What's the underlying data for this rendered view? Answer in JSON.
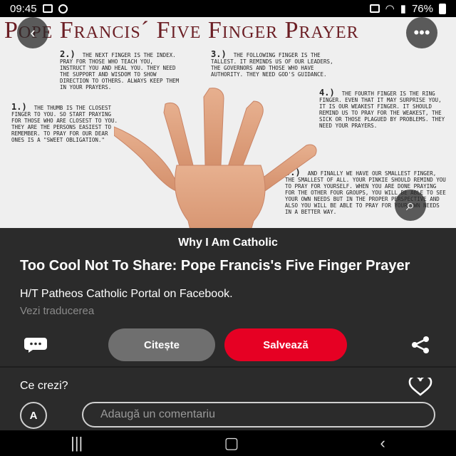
{
  "status_bar": {
    "time": "09:45",
    "battery": "76%"
  },
  "image": {
    "title": "Pope Francis´ Five Finger Prayer",
    "steps": [
      {
        "num": "1.)",
        "text": "The thumb is the closest finger to you. So start praying for those who are closest to you. They are the persons easiest to remember. To pray for our dear ones is a \"sweet obligation.\""
      },
      {
        "num": "2.)",
        "text": "The next finger is the index. Pray for those who teach you, instruct you and heal you. They need the support and wisdom to show direction to others. Always keep them in your prayers."
      },
      {
        "num": "3.)",
        "text": "The following finger is the tallest. It reminds us of our leaders, the governors and those who have authority. They need God's guidance."
      },
      {
        "num": "4.)",
        "text": "The fourth finger is the ring finger. Even that it may surprise you, it is our weakest finger. It should remind us to pray for the weakest, the sick or those plagued by problems. They need your prayers."
      },
      {
        "num": "5.)",
        "text": "And finally we have our smallest finger, the smallest of all. Your pinkie should remind you to pray for yourself. When you are done praying for the other four groups, you will be able to see your own needs but in the proper perspective and also you will be able to pray for your own needs in a better way."
      }
    ]
  },
  "board_name": "Why I Am Catholic",
  "pin": {
    "title": "Too Cool Not To Share: Pope Francis's Five Finger Prayer",
    "description": "H/T Patheos Catholic Portal on Facebook.",
    "translate_link": "Vezi traducerea"
  },
  "actions": {
    "read_label": "Citește",
    "save_label": "Salvează"
  },
  "comments": {
    "prompt": "Ce crezi?",
    "avatar_letter": "A",
    "placeholder": "Adaugă un comentariu"
  },
  "colors": {
    "save": "#e60023",
    "title": "#6b1e24"
  }
}
